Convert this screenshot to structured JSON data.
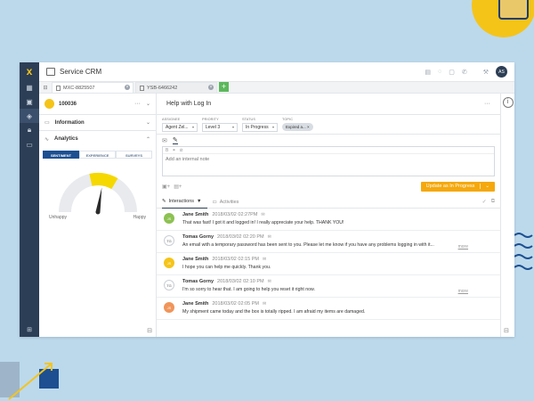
{
  "app": {
    "title": "Service CRM",
    "logo": "x",
    "user_initials": "AS"
  },
  "header_icons": [
    "calendar-icon",
    "chat-icon",
    "speech-icon",
    "phone-icon",
    "wrench-icon"
  ],
  "tabs": [
    {
      "label": "MXC-8825507",
      "active": true
    },
    {
      "label": "YSB-6466242",
      "active": false
    }
  ],
  "record": {
    "id": "100036",
    "sections": [
      {
        "label": "Information"
      },
      {
        "label": "Analytics"
      }
    ]
  },
  "analytics": {
    "tabs": [
      "SENTIMENT",
      "EXPERIENCE",
      "SURVEYS"
    ],
    "gauge_low": "Unhappy",
    "gauge_high": "Happy",
    "sentiment_level": 0.55,
    "colors": {
      "gauge_track": "#e8eaed",
      "gauge_fill": "#f5d800",
      "needle": "#2a2a2a"
    }
  },
  "case": {
    "title": "Help with Log In",
    "fields": [
      {
        "label": "ASSIGNEE",
        "value": "Agent Zel..."
      },
      {
        "label": "PRIORITY",
        "value": "Level 3"
      },
      {
        "label": "STATUS",
        "value": "In Progress"
      },
      {
        "label": "TOPIC",
        "value": "Expired a..."
      }
    ]
  },
  "composer": {
    "placeholder": "Add an internal note",
    "submit_label": "Update as In Progress",
    "submit_color": "#f5a80c"
  },
  "list_tabs": [
    {
      "label": "Interactions"
    },
    {
      "label": "Activities"
    }
  ],
  "interactions": [
    {
      "initials": "JS",
      "name": "Jane Smith",
      "time": "2018/03/02 02:27PM",
      "text": "That was fast! I got it and logged in! I really appreciate your help. THANK YOU!",
      "color": "#8cc152",
      "more": ""
    },
    {
      "initials": "TG",
      "name": "Tomas Gorny",
      "time": "2018/03/02 02:20 PM",
      "text": "An email with a temporary password has been sent to you. Please let me know if you have any problems logging in with it...",
      "color": "",
      "more": "more"
    },
    {
      "initials": "JS",
      "name": "Jane Smith",
      "time": "2018/03/02 02:15 PM",
      "text": "I hope you can help me quickly. Thank you.",
      "color": "#f5c419",
      "more": ""
    },
    {
      "initials": "TG",
      "name": "Tomas Gorny",
      "time": "2018/03/02 02:10 PM",
      "text": "I'm so sorry to hear that. I am going to help you reset it right now.",
      "color": "",
      "more": "more"
    },
    {
      "initials": "JS",
      "name": "Jane Smith",
      "time": "2018/03/02 02:05 PM",
      "text": "My shipment came today and the box is totally ripped. I am afraid my items are damaged.",
      "color": "#f0955a",
      "more": ""
    }
  ]
}
